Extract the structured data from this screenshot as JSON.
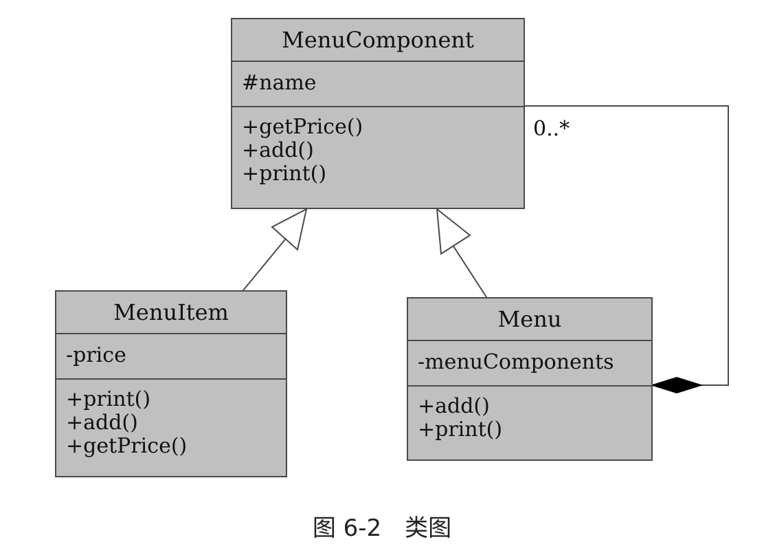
{
  "classes": {
    "menu_component": {
      "name": "MenuComponent",
      "attributes": [
        "#name"
      ],
      "operations": [
        "+getPrice()",
        "+add()",
        "+print()"
      ]
    },
    "menu_item": {
      "name": "MenuItem",
      "attributes": [
        "-price"
      ],
      "operations": [
        "+print()",
        "+add()",
        "+getPrice()"
      ]
    },
    "menu": {
      "name": "Menu",
      "attributes": [
        "-menuComponents"
      ],
      "operations": [
        "+add()",
        "+print()"
      ]
    }
  },
  "relationships": {
    "composition_multiplicity": "0..*"
  },
  "caption": "图 6-2　类图",
  "colors": {
    "class_fill": "#c0c0c0",
    "line": "#4a4a4a",
    "composition_diamond": "#000000"
  }
}
